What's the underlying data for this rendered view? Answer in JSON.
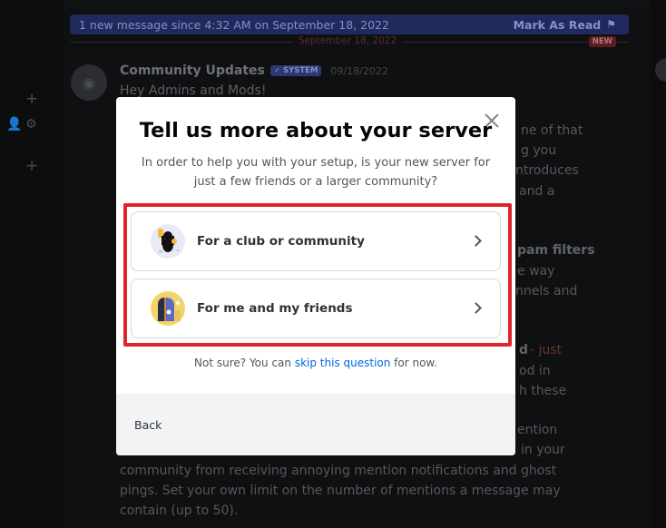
{
  "banner": {
    "text": "1 new message since 4:32 AM on September 18, 2022",
    "mark_as_read": "Mark As Read"
  },
  "divider": {
    "date": "September 18, 2022",
    "new_tag": "NEW"
  },
  "message": {
    "author": "Community Updates",
    "tag": "✓ SYSTEM",
    "timestamp": "09/18/2022",
    "greeting": "Hey Admins and Mods!",
    "fragments": {
      "f1": "ne of that",
      "f2": "g you",
      "f3": "ntroduces",
      "f4": "and a",
      "f5": "pam filters",
      "f6": "e way",
      "f7": "nnels and",
      "f8": "d",
      "f9": "- just",
      "f10": "od in",
      "f11": "h these",
      "f12": "ention",
      "f13": "in your"
    },
    "paragraph": "community from receiving annoying mention notifications and ghost pings. Set your own limit on the number of mentions a message may contain (up to 50)."
  },
  "modal": {
    "title": "Tell us more about your server",
    "subtitle": "In order to help you with your setup, is your new server for just a few friends or a larger community?",
    "options": [
      {
        "label": "For a club or community",
        "icon": "club-icon"
      },
      {
        "label": "For me and my friends",
        "icon": "friends-icon"
      }
    ],
    "not_sure_prefix": "Not sure? You can ",
    "skip_link": "skip this question",
    "not_sure_suffix": " for now.",
    "back": "Back"
  },
  "colors": {
    "highlight": "#e0242c",
    "link": "#0068e0",
    "footer_bg": "#f2f3f5"
  }
}
